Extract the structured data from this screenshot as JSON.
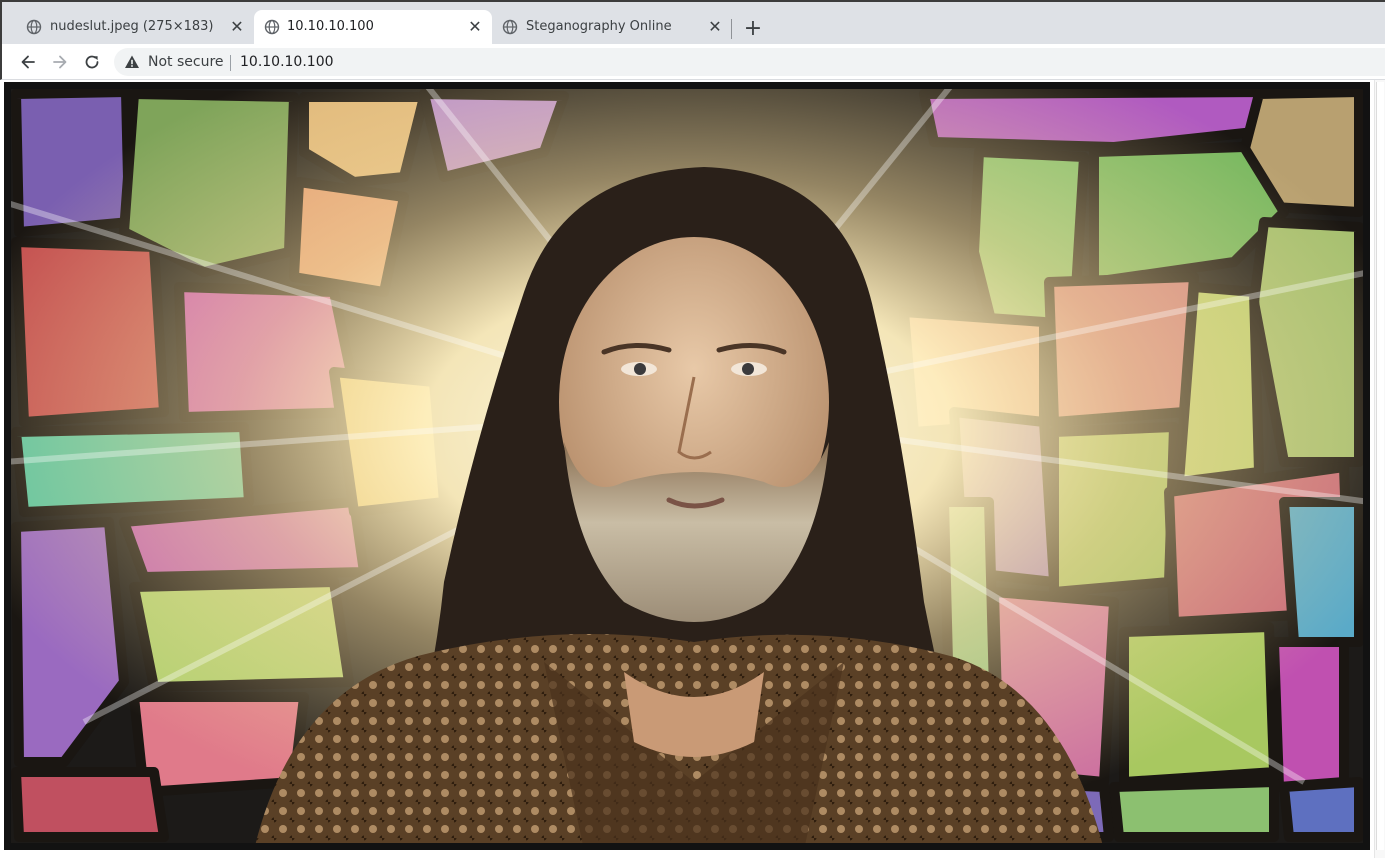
{
  "tabs": [
    {
      "title": "nudeslut.jpeg (275×183)",
      "icon": "globe-icon",
      "active": false
    },
    {
      "title": "10.10.10.100",
      "icon": "globe-icon",
      "active": true
    },
    {
      "title": "Steganography Online",
      "icon": "globe-icon",
      "active": false
    }
  ],
  "toolbar": {
    "security_label": "Not secure",
    "url": "10.10.10.100"
  },
  "page": {
    "image_subject": "stained-glass-portrait",
    "colors": {
      "beard": "#8a7b66",
      "shirt": "#5a4026",
      "halo": "#fff4c8"
    }
  }
}
